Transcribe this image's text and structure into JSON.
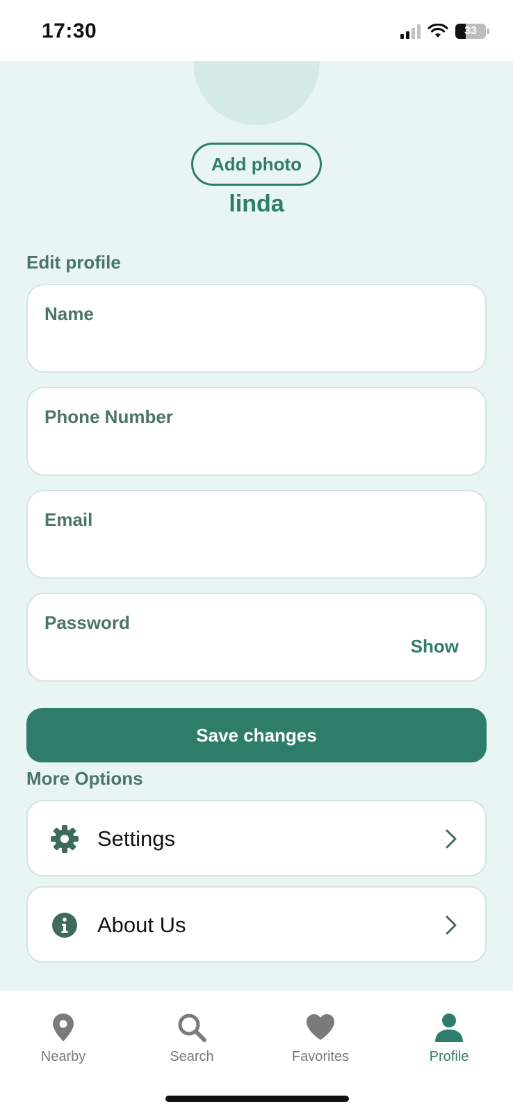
{
  "status_bar": {
    "time": "17:30",
    "battery": "33"
  },
  "profile": {
    "add_photo_label": "Add photo",
    "username": "linda"
  },
  "edit_profile": {
    "title": "Edit profile",
    "fields": [
      {
        "label": "Name",
        "value": ""
      },
      {
        "label": "Phone Number",
        "value": ""
      },
      {
        "label": "Email",
        "value": ""
      },
      {
        "label": "Password",
        "value": ""
      }
    ],
    "show_label": "Show",
    "save_label": "Save changes"
  },
  "more_options": {
    "title": "More Options",
    "items": [
      {
        "label": "Settings",
        "icon": "gear-icon"
      },
      {
        "label": "About Us",
        "icon": "info-icon"
      }
    ]
  },
  "bottom_nav": {
    "items": [
      {
        "label": "Nearby",
        "icon": "map-pin-icon",
        "active": false
      },
      {
        "label": "Search",
        "icon": "search-icon",
        "active": false
      },
      {
        "label": "Favorites",
        "icon": "heart-icon",
        "active": false
      },
      {
        "label": "Profile",
        "icon": "user-icon",
        "active": true
      }
    ]
  },
  "colors": {
    "accent": "#2e7d6b",
    "background": "#e9f5f3",
    "label": "#4a7568",
    "inactive_nav": "#7a7a7a"
  }
}
